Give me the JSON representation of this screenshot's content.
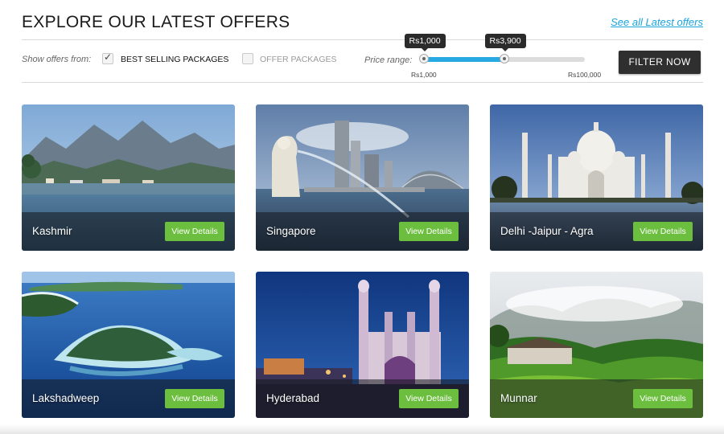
{
  "header": {
    "title": "EXPLORE OUR LATEST OFFERS",
    "see_all": "See all Latest offers"
  },
  "filters": {
    "show_label": "Show offers from:",
    "options": [
      {
        "label": "BEST SELLING PACKAGES",
        "checked": true
      },
      {
        "label": "OFFER PACKAGES",
        "checked": false
      }
    ],
    "price_label": "Price range:",
    "price_min": "Rs1,000",
    "price_max": "Rs100,000",
    "selected_low": "Rs1,000",
    "selected_high": "Rs3,900",
    "selected_low_fraction": 0.0,
    "selected_high_fraction": 0.5,
    "filter_button": "FILTER NOW"
  },
  "offers": [
    {
      "name": "Kashmir",
      "button": "View Details",
      "scene": "mountains-lake-icon"
    },
    {
      "name": "Singapore",
      "button": "View Details",
      "scene": "merlion-skyline-icon"
    },
    {
      "name": "Delhi -Jaipur - Agra",
      "button": "View Details",
      "scene": "taj-mahal-icon"
    },
    {
      "name": "Lakshadweep",
      "button": "View Details",
      "scene": "island-lagoon-icon"
    },
    {
      "name": "Hyderabad",
      "button": "View Details",
      "scene": "charminar-icon"
    },
    {
      "name": "Munnar",
      "button": "View Details",
      "scene": "misty-hills-icon"
    }
  ],
  "colors": {
    "accent": "#1aa3d9",
    "slider_fill": "#27a9e1",
    "view_button": "#6cbe3f",
    "filter_button": "#2f2f2f"
  }
}
